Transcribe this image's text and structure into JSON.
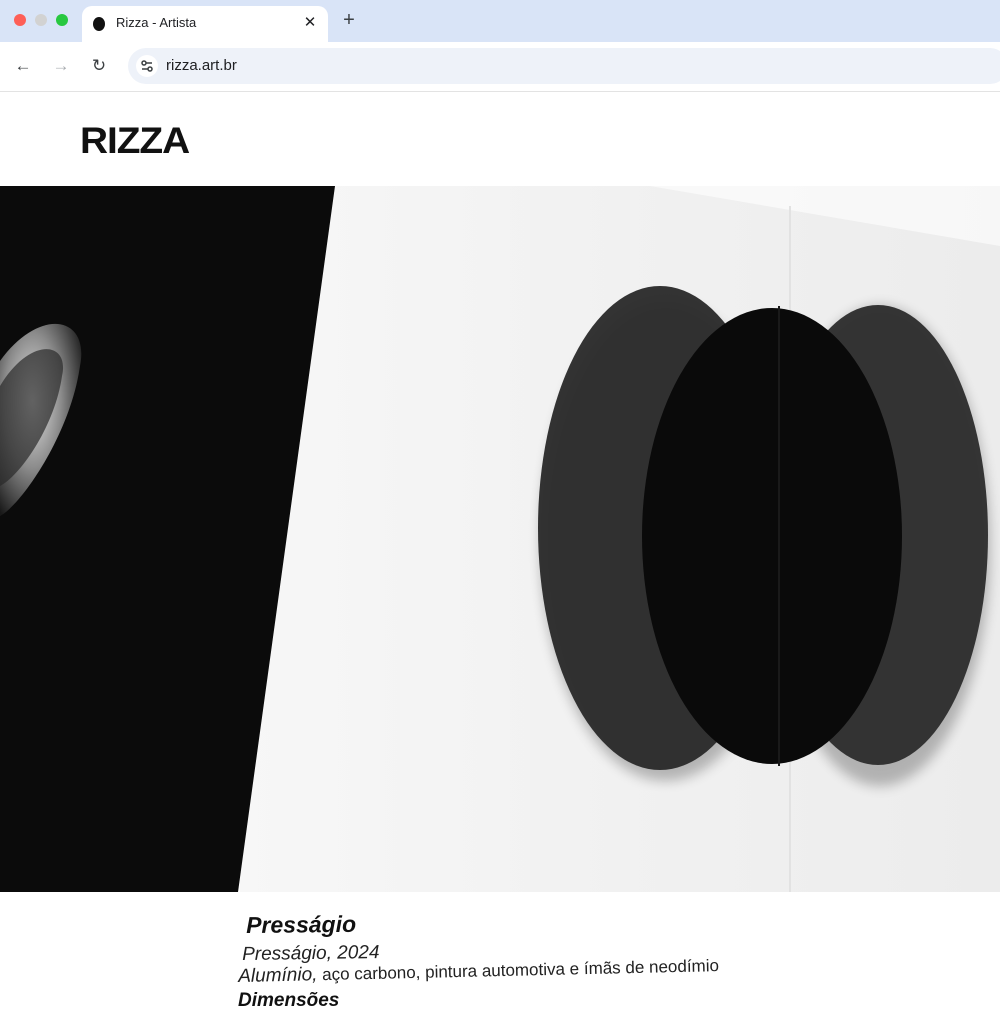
{
  "browser": {
    "tab_title": "Rizza - Artista",
    "tab_close": "✕",
    "new_tab": "+",
    "url": "rizza.art.br",
    "back": "←",
    "forward": "→",
    "reload": "↻"
  },
  "page": {
    "logo": "RIZZA",
    "artwork": {
      "title": "Presságio",
      "subtitle": "Presságio, 2024",
      "materials_lead": "Alumínio,",
      "materials_rest": " aço carbono, pintura automotiva e ímãs de neodímio",
      "next_line": "Dimensões"
    }
  },
  "colors": {
    "tabbar": "#d9e4f7",
    "omnibox": "#eef2f9",
    "dark_panel": "#0b0b0b",
    "wall": "#f3f3f3",
    "disc": "#2a2a2a"
  }
}
